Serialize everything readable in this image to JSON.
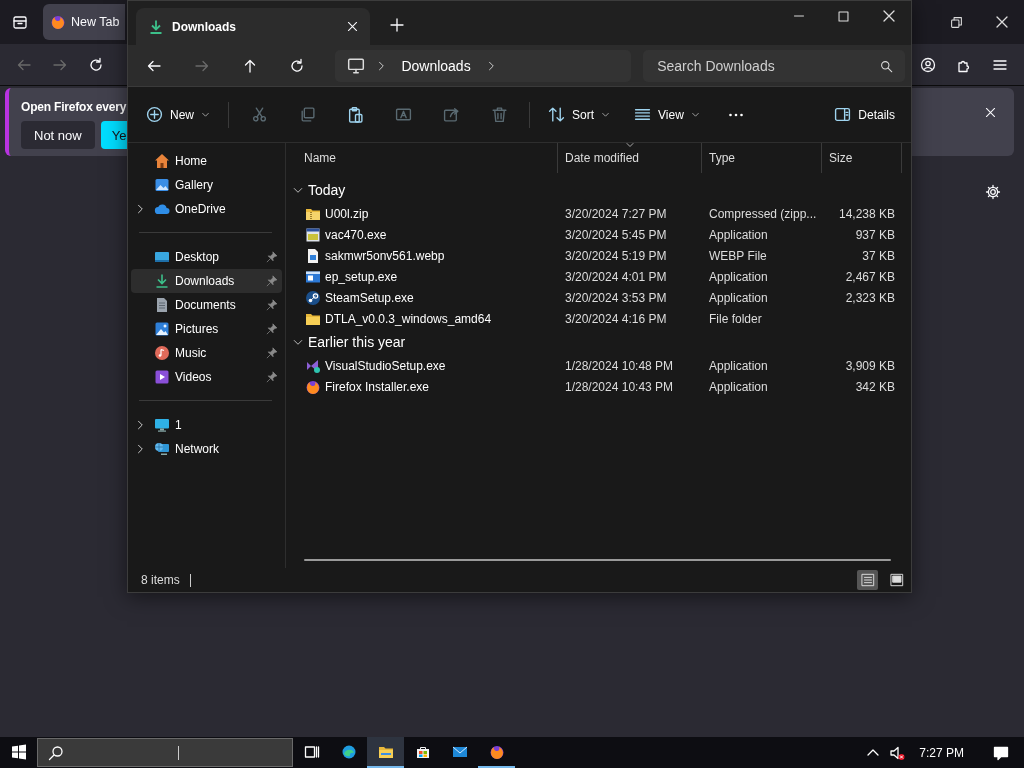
{
  "firefox": {
    "tab_title": "New Tab",
    "back_disabled": true,
    "forward_disabled": true,
    "notification": {
      "message": "Open Firefox every",
      "buttons": [
        {
          "label": "Not now",
          "kind": "secondary"
        },
        {
          "label": "Ye",
          "kind": "primary"
        }
      ]
    }
  },
  "explorer": {
    "tab_title": "Downloads",
    "back_disabled": false,
    "forward_disabled": true,
    "breadcrumb": [
      "Downloads"
    ],
    "search": {
      "placeholder": "Search Downloads"
    },
    "commands": [
      {
        "kind": "new",
        "label": "New",
        "disabled": false
      },
      {
        "kind": "cut",
        "disabled": true
      },
      {
        "kind": "copy",
        "disabled": true
      },
      {
        "kind": "paste",
        "disabled": false
      },
      {
        "kind": "rename",
        "disabled": true
      },
      {
        "kind": "share",
        "disabled": true
      },
      {
        "kind": "delete",
        "disabled": true
      },
      {
        "kind": "sort",
        "label": "Sort",
        "disabled": false
      },
      {
        "kind": "view",
        "label": "View",
        "disabled": false
      },
      {
        "kind": "more"
      }
    ],
    "details_label": "Details",
    "sidebar": [
      {
        "items": [
          {
            "label": "Home",
            "kind": "home",
            "selected": false,
            "pinned": false,
            "expandable": false
          },
          {
            "label": "Gallery",
            "kind": "gallery",
            "selected": false,
            "pinned": false,
            "expandable": false
          },
          {
            "label": "OneDrive",
            "kind": "cloud",
            "selected": false,
            "pinned": false,
            "expandable": true
          }
        ]
      },
      {
        "items": [
          {
            "label": "Desktop",
            "kind": "desktop",
            "selected": false,
            "pinned": true,
            "expandable": false
          },
          {
            "label": "Downloads",
            "kind": "download",
            "selected": true,
            "pinned": true,
            "expandable": false
          },
          {
            "label": "Documents",
            "kind": "document",
            "selected": false,
            "pinned": true,
            "expandable": false
          },
          {
            "label": "Pictures",
            "kind": "pictures",
            "selected": false,
            "pinned": true,
            "expandable": false
          },
          {
            "label": "Music",
            "kind": "music",
            "selected": false,
            "pinned": true,
            "expandable": false
          },
          {
            "label": "Videos",
            "kind": "videos",
            "selected": false,
            "pinned": true,
            "expandable": false
          }
        ]
      },
      {
        "items": [
          {
            "label": "1",
            "kind": "pc",
            "selected": false,
            "pinned": false,
            "expandable": true
          },
          {
            "label": "Network",
            "kind": "network",
            "selected": false,
            "pinned": false,
            "expandable": true
          }
        ]
      }
    ],
    "columns": [
      {
        "label": "Name",
        "sorted": false
      },
      {
        "label": "Date modified",
        "sorted": true
      },
      {
        "label": "Type",
        "sorted": false
      },
      {
        "label": "Size",
        "sorted": false
      }
    ],
    "groups": [
      {
        "title": "Today",
        "expanded": true,
        "files": [
          {
            "name": "U00l.zip",
            "kind": "zip",
            "date": "3/20/2024 7:27 PM",
            "type": "Compressed (zipp...",
            "size": "14,238 KB"
          },
          {
            "name": "vac470.exe",
            "kind": "exe",
            "date": "3/20/2024 5:45 PM",
            "type": "Application",
            "size": "937 KB"
          },
          {
            "name": "sakmwr5onv561.webp",
            "kind": "image",
            "date": "3/20/2024 5:19 PM",
            "type": "WEBP File",
            "size": "37 KB"
          },
          {
            "name": "ep_setup.exe",
            "kind": "window",
            "date": "3/20/2024 4:01 PM",
            "type": "Application",
            "size": "2,467 KB"
          },
          {
            "name": "SteamSetup.exe",
            "kind": "steam",
            "date": "3/20/2024 3:53 PM",
            "type": "Application",
            "size": "2,323 KB"
          },
          {
            "name": "DTLA_v0.0.3_windows_amd64",
            "kind": "folder",
            "date": "3/20/2024 4:16 PM",
            "type": "File folder"
          }
        ]
      },
      {
        "title": "Earlier this year",
        "expanded": true,
        "files": [
          {
            "name": "VisualStudioSetup.exe",
            "kind": "vs",
            "date": "1/28/2024 10:48 PM",
            "type": "Application",
            "size": "3,909 KB"
          },
          {
            "name": "Firefox Installer.exe",
            "kind": "firefox",
            "date": "1/28/2024 10:43 PM",
            "type": "Application",
            "size": "342 KB"
          }
        ]
      }
    ],
    "status": "8 items",
    "view_modes": [
      {
        "kind": "details",
        "selected": true
      },
      {
        "kind": "tiles",
        "selected": false
      }
    ]
  },
  "taskbar": {
    "apps": [
      {
        "kind": "task-view",
        "active": false,
        "running": false
      },
      {
        "kind": "edge",
        "active": false,
        "running": false
      },
      {
        "kind": "explorer",
        "active": true,
        "running": true
      },
      {
        "kind": "store",
        "active": false,
        "running": false
      },
      {
        "kind": "mail",
        "active": false,
        "running": false
      },
      {
        "kind": "firefox",
        "active": false,
        "running": true
      }
    ],
    "time": "7:27 PM"
  }
}
